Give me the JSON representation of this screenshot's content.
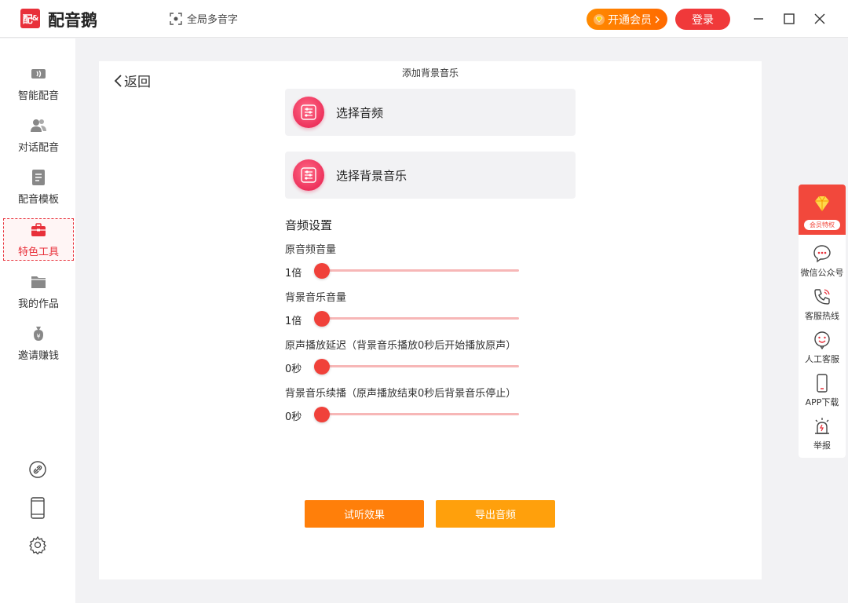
{
  "titlebar": {
    "logo_text": "配",
    "app_name": "配音鹅",
    "polyphone_label": "全局多音字",
    "vip_button": "开通会员",
    "login_button": "登录"
  },
  "sidebar": {
    "items": [
      {
        "label": "智能配音",
        "icon": "smart-dub-icon"
      },
      {
        "label": "对话配音",
        "icon": "dialogue-icon"
      },
      {
        "label": "配音模板",
        "icon": "template-icon"
      },
      {
        "label": "特色工具",
        "icon": "toolbox-icon",
        "active": true
      },
      {
        "label": "我的作品",
        "icon": "folder-icon"
      },
      {
        "label": "邀请赚钱",
        "icon": "money-bag-icon"
      }
    ]
  },
  "main": {
    "back_label": "返回",
    "page_title": "添加背景音乐",
    "select_audio": "选择音频",
    "select_bgm": "选择背景音乐",
    "settings_title": "音频设置",
    "sliders": [
      {
        "label": "原音频音量",
        "value_text": "1倍",
        "value": 0
      },
      {
        "label": "背景音乐音量",
        "value_text": "1倍",
        "value": 0
      },
      {
        "label": "原声播放延迟（背景音乐播放0秒后开始播放原声）",
        "value_text": "0秒",
        "value": 0
      },
      {
        "label": "背景音乐续播（原声播放结束0秒后背景音乐停止）",
        "value_text": "0秒",
        "value": 0
      }
    ],
    "preview_button": "试听效果",
    "export_button": "导出音频"
  },
  "right_panel": {
    "vip_tag": "会员特权",
    "items": [
      {
        "label": "微信公众号",
        "icon": "wechat-chat-icon"
      },
      {
        "label": "客服热线",
        "icon": "phone-icon"
      },
      {
        "label": "人工客服",
        "icon": "smile-chat-icon"
      },
      {
        "label": "APP下载",
        "icon": "mobile-icon"
      },
      {
        "label": "举报",
        "icon": "alarm-icon"
      }
    ]
  },
  "colors": {
    "brand_red": "#e8303a",
    "slider_thumb": "#f0413a",
    "slider_track": "#f7b7b7",
    "preview_orange": "#ff7f0a",
    "export_orange": "#ffa00c"
  }
}
